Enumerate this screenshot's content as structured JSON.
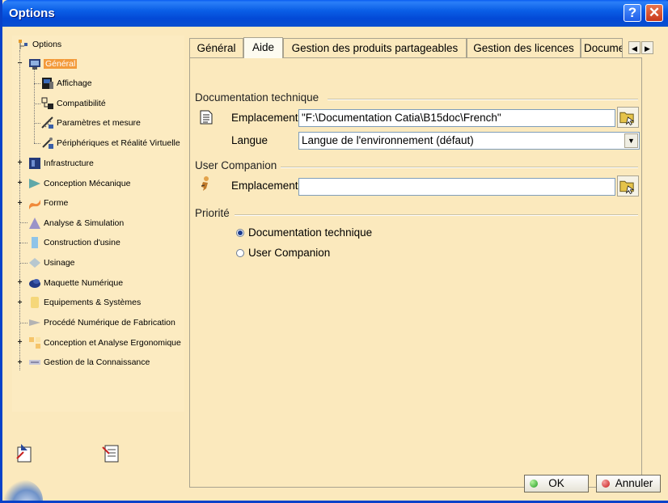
{
  "window": {
    "title": "Options"
  },
  "tree": {
    "items": [
      {
        "label": "Options"
      },
      {
        "label": "Général"
      },
      {
        "label": "Affichage"
      },
      {
        "label": "Compatibilité"
      },
      {
        "label": "Paramètres et mesure"
      },
      {
        "label": "Périphériques et Réalité Virtuelle"
      },
      {
        "label": "Infrastructure"
      },
      {
        "label": "Conception Mécanique"
      },
      {
        "label": "Forme"
      },
      {
        "label": "Analyse & Simulation"
      },
      {
        "label": "Construction d'usine"
      },
      {
        "label": "Usinage"
      },
      {
        "label": "Maquette Numérique"
      },
      {
        "label": "Equipements & Systèmes"
      },
      {
        "label": "Procédé Numérique de Fabrication"
      },
      {
        "label": "Conception et Analyse Ergonomique"
      },
      {
        "label": "Gestion de la Connaissance"
      }
    ],
    "selected": "Général"
  },
  "tabs": [
    "Général",
    "Aide",
    "Gestion des produits partageables",
    "Gestion des licences",
    "Documen"
  ],
  "active_tab": "Aide",
  "doc": {
    "section": "Documentation technique",
    "location_label": "Emplacement",
    "location_value": "\"F:\\Documentation Catia\\B15doc\\French\"",
    "language_label": "Langue",
    "language_value": "Langue de l'environnement (défaut)"
  },
  "companion": {
    "section": "User Companion",
    "location_label": "Emplacement",
    "location_value": ""
  },
  "priority": {
    "section": "Priorité",
    "options": [
      "Documentation technique",
      "User Companion"
    ],
    "selected": "Documentation technique"
  },
  "buttons": {
    "ok": "OK",
    "cancel": "Annuler"
  },
  "colors": {
    "title_bar": "#0a5ee6",
    "selection": "#f39a3a",
    "panel_bg": "#fbe9bd"
  }
}
